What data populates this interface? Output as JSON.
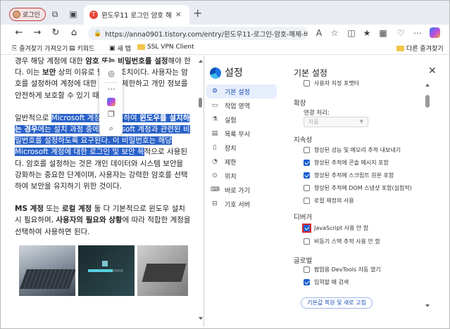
{
  "browser": {
    "profile_label": "로그인",
    "tab_title": "윈도우11 로그인 암호 해제 - 비밀",
    "tab_favicon": "T",
    "address_url": "https://anna0901.tistory.com/entry/윈도우11-로그인-암호-해제-비밀번...",
    "colors": {
      "tabstrip": "#e8ecf2",
      "accent": "#1a5fd0",
      "profile_border": "#c23b3b"
    }
  },
  "bookmarks": {
    "import_label": "즐겨찾기 가져오기",
    "keyword_label": "키워드",
    "new_label": "새 탭",
    "vpn_label": "SSL VPN Client",
    "other_label": "다른 즐겨찾기"
  },
  "article": {
    "p1": {
      "a": "경우 해당 계정에 대한 ",
      "b": "암호 또는 비밀번호를 설정",
      "c": "해야 한다. 이는 ",
      "d": "보안",
      "e": " 상의 이유로 필요한 조치이다. 사용자는 암호를 설정하여 계정에 대한 접근을 제한하고 개인 정보를 안전하게 보호할 수 있기 때문이다."
    },
    "p2": {
      "a": "일반적으로 ",
      "hl1": "Microsoft 계정을 사용하여 ",
      "hl2": "윈도우를 설치하는 경우",
      "hl3": "에는 설치 과정 중에 Microsoft 계정과 관련된 비밀번호를 설정하도록 요구된다. 이 비밀번호는 해당 Microsoft 계정에 대한 로그인 및 보안 목",
      "b": "적으로 사용된다. 암호를 설정하는 것은 개인 데이터와 시스템 보안을 강화하는 중요한 단계이며, 사용자는 강력한 암호를 선택하여 보안을 유지하기 위한 것이다."
    },
    "p3": {
      "a": "MS 계정",
      "b": " 또는 ",
      "c": "로컬 계정",
      "d": " 둘 다 기본적으로 윈도우 설치 시 필요하며, ",
      "e": "사용자의 필요와 상황",
      "f": "에 따라 적합한 계정을 선택하여 사용하면 된다."
    },
    "image2_progress": 0.7
  },
  "devtools": {
    "title": "설정",
    "sidebar": [
      {
        "label": "기본 설정",
        "icon": "gear-icon",
        "glyph": "⚙",
        "active": true
      },
      {
        "label": "작업 영역",
        "icon": "folder-icon",
        "glyph": "▭",
        "active": false
      },
      {
        "label": "실험",
        "icon": "flask-icon",
        "glyph": "⚗",
        "active": false
      },
      {
        "label": "목록 무시",
        "icon": "ignore-icon",
        "glyph": "▤",
        "active": false
      },
      {
        "label": "장치",
        "icon": "device-icon",
        "glyph": "▯",
        "active": false
      },
      {
        "label": "제한",
        "icon": "throttle-icon",
        "glyph": "◔",
        "active": false
      },
      {
        "label": "위치",
        "icon": "location-icon",
        "glyph": "⊙",
        "active": false
      },
      {
        "label": "바로 가기",
        "icon": "shortcut-icon",
        "glyph": "⌨",
        "active": false
      },
      {
        "label": "기호 서버",
        "icon": "symbol-server-icon",
        "glyph": "⊟",
        "active": false
      }
    ],
    "section_title": "기본 설정",
    "top_item": {
      "label": "사용자 지정 포맷터",
      "checked": false
    },
    "extension": {
      "head": "확장",
      "sub_label": "연결 처리:",
      "select_value": "자동"
    },
    "persistence": {
      "head": "지속성",
      "items": [
        {
          "label": "향상된 성능 및 메모리 추적 내보내기",
          "checked": false
        },
        {
          "label": "향상된 추적에 콘솔 메시지 포함",
          "checked": true
        },
        {
          "label": "향상된 추적에 스크립트 원본 포함",
          "checked": true
        },
        {
          "label": "향상된 추적에 DOM 스냅샷 포함(실험적)",
          "checked": false
        },
        {
          "label": "로컬 재정의 사용",
          "checked": false
        }
      ]
    },
    "debugger": {
      "head": "디버거",
      "items": [
        {
          "label": "JavaScript 사용 안 함",
          "checked": true,
          "focused": true
        },
        {
          "label": "비동기 스택 추적 사용 안 함",
          "checked": false
        }
      ]
    },
    "global": {
      "head": "글로벌",
      "items": [
        {
          "label": "팝업용 DevTools 자동 열기",
          "checked": false
        },
        {
          "label": "입력할 때 검색",
          "checked": true
        }
      ]
    },
    "reset_label": "기본값 복원 및 새로 고침",
    "colors": {
      "active_bg": "#e7eefc",
      "active_text": "#1a4fb8",
      "focus_ring": "#d2222a"
    }
  }
}
